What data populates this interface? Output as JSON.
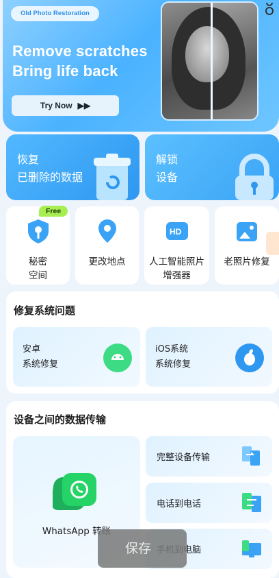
{
  "banner": {
    "tag": "Old Photo Restoration",
    "headline_line1": "Remove scratches",
    "headline_line2": "Bring life back",
    "button_label": "Try Now",
    "button_icon": "double-chevron-right-icon"
  },
  "feature_cards": {
    "recover_line1": "恢复",
    "recover_line2": "已删除的数据",
    "unlock_line1": "解锁",
    "unlock_line2": "设备"
  },
  "tools": {
    "badge": "Free",
    "items": [
      {
        "label_line1": "秘密",
        "label_line2": "空间",
        "icon": "shield-key-icon"
      },
      {
        "label_line1": "更改地点",
        "label_line2": "",
        "icon": "location-pin-icon"
      },
      {
        "label_line1": "人工智能照片",
        "label_line2": "增强器",
        "icon": "hd-photo-icon"
      },
      {
        "label_line1": "老照片修复",
        "label_line2": "",
        "icon": "photo-restore-icon"
      }
    ]
  },
  "repair": {
    "title": "修复系统问题",
    "android_line1": "安卓",
    "android_line2": "系统修复",
    "ios_line1": "iOS系统",
    "ios_line2": "系统修复"
  },
  "transfer": {
    "title": "设备之间的数据传输",
    "whatsapp": "WhatsApp 转账",
    "full": "完整设备传输",
    "phone_to_phone": "电话到电话",
    "phone_to_pc": "手机到电脑"
  },
  "toast": "保存",
  "colors": {
    "accent": "#2e97f0",
    "free_badge": "#a7ee52",
    "android_green": "#3ddc84",
    "whatsapp_green": "#25d366"
  }
}
